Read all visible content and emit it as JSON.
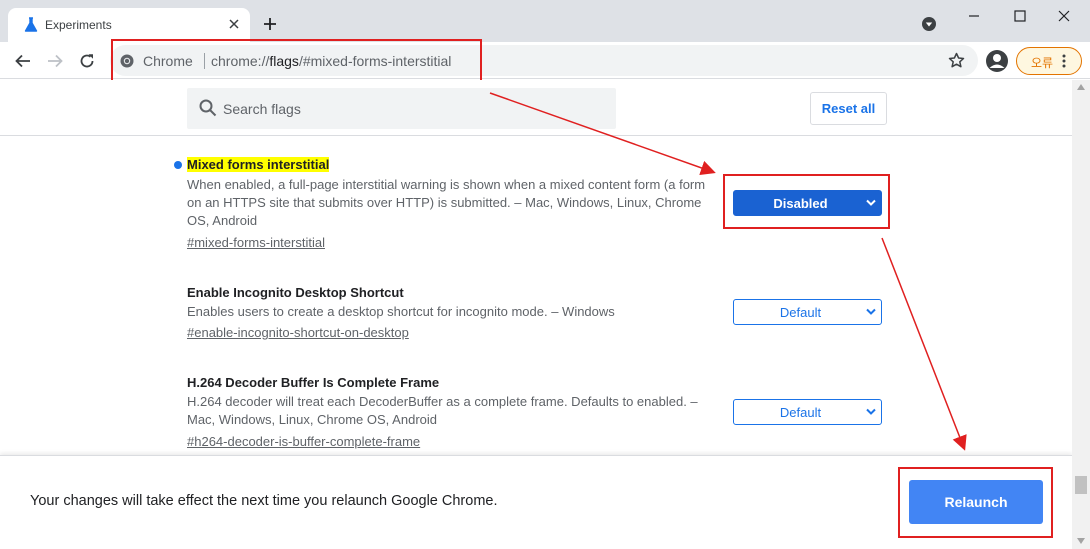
{
  "tab": {
    "title": "Experiments",
    "favicon": "flask-icon"
  },
  "toolbar": {
    "omnibox_site": "Chrome",
    "url_scheme": "chrome://",
    "url_host": "flags",
    "url_path": "/#mixed-forms-interstitial",
    "error_chip": "오류"
  },
  "header": {
    "search_placeholder": "Search flags",
    "reset_label": "Reset all"
  },
  "flags": [
    {
      "title": "Mixed forms interstitial",
      "description": "When enabled, a full-page interstitial warning is shown when a mixed content form (a form on an HTTPS site that submits over HTTP) is submitted. – Mac, Windows, Linux, Chrome OS, Android",
      "link": "#mixed-forms-interstitial",
      "value": "Disabled",
      "modified": true
    },
    {
      "title": "Enable Incognito Desktop Shortcut",
      "description": "Enables users to create a desktop shortcut for incognito mode. – Windows",
      "link": "#enable-incognito-shortcut-on-desktop",
      "value": "Default",
      "modified": false
    },
    {
      "title": "H.264 Decoder Buffer Is Complete Frame",
      "description": "H.264 decoder will treat each DecoderBuffer as a complete frame. Defaults to enabled. – Mac, Windows, Linux, Chrome OS, Android",
      "link": "#h264-decoder-is-buffer-complete-frame",
      "value": "Default",
      "modified": false
    }
  ],
  "relaunch": {
    "message": "Your changes will take effect the next time you relaunch Google Chrome.",
    "button_label": "Relaunch"
  },
  "colors": {
    "accent": "#1a73e8",
    "highlight": "#ffff00",
    "annotation": "#e02020",
    "relaunch_button": "#4285f4"
  }
}
